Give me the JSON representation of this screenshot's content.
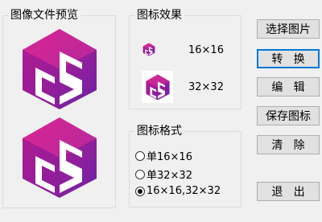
{
  "preview_group": {
    "title": "图像文件预览"
  },
  "effect_group": {
    "title": "图标效果",
    "size_small": "16×16",
    "size_large": "32×32"
  },
  "format_group": {
    "title": "图标格式",
    "options": [
      {
        "label": "单16×16",
        "selected": false
      },
      {
        "label": "单32×32",
        "selected": false
      },
      {
        "label": "16×16,32×32",
        "selected": true
      }
    ]
  },
  "buttons": {
    "select_image": "选择图片",
    "convert": "转   换",
    "edit": "编   辑",
    "save_icon": "保存图标",
    "clear": "清   除",
    "exit": "退   出"
  },
  "icon": {
    "name": "magenta-cube-logo-icon",
    "color_top": "#c41c8c",
    "color_bottom": "#7a1fa0"
  }
}
